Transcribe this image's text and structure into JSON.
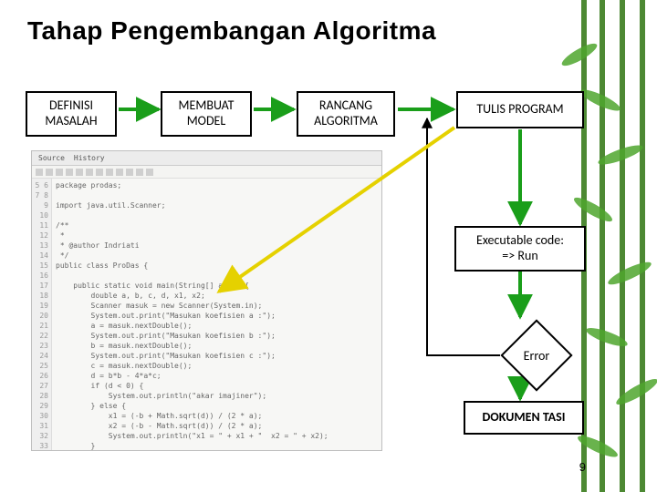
{
  "title": "Tahap Pengembangan Algoritma",
  "boxes": {
    "definisi": "DEFINISI\nMASALAH",
    "model": "MEMBUAT\nMODEL",
    "rancang": "RANCANG\nALGORITMA",
    "program": "TULIS PROGRAM",
    "exec": "Executable code:\n=> Run",
    "error": "Error",
    "dokumentasi": "DOKUMEN TASI"
  },
  "code_pane": {
    "tab_source": "Source",
    "tab_history": "History",
    "lines": [
      "package prodas;",
      "",
      "import java.util.Scanner;",
      "",
      "/**",
      " *",
      " * @author Indriati",
      " */",
      "public class ProDas {",
      "",
      "    public static void main(String[] args) {",
      "        double a, b, c, d, x1, x2;",
      "        Scanner masuk = new Scanner(System.in);",
      "        System.out.print(\"Masukan koefisien a :\");",
      "        a = masuk.nextDouble();",
      "        System.out.print(\"Masukan koefisien b :\");",
      "        b = masuk.nextDouble();",
      "        System.out.print(\"Masukan koefisien c :\");",
      "        c = masuk.nextDouble();",
      "        d = b*b - 4*a*c;",
      "        if (d < 0) {",
      "            System.out.println(\"akar imajiner\");",
      "        } else {",
      "            x1 = (-b + Math.sqrt(d)) / (2 * a);",
      "            x2 = (-b - Math.sqrt(d)) / (2 * a);",
      "            System.out.println(\"x1 = \" + x1 + \"  x2 = \" + x2);",
      "        }",
      "    }",
      "}"
    ]
  },
  "page_number": "9"
}
